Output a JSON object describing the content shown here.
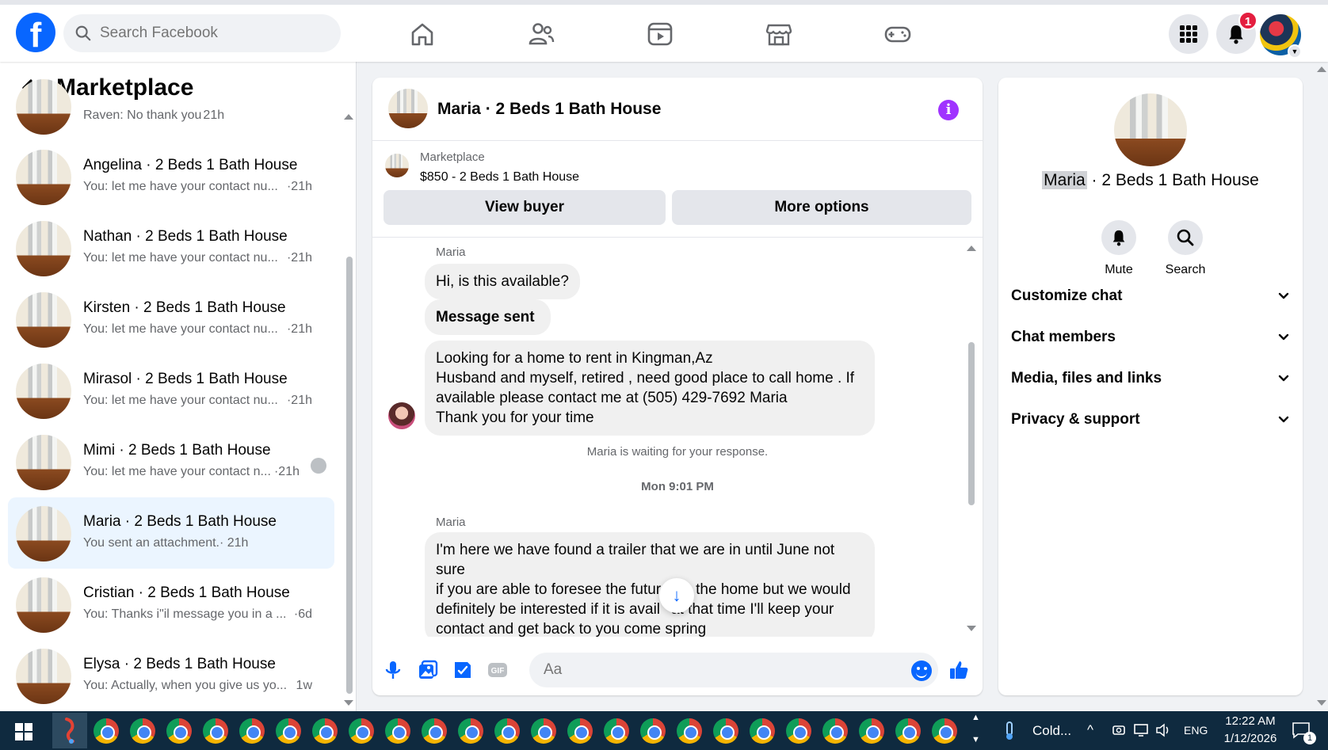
{
  "topbar": {
    "search_placeholder": "Search Facebook",
    "notification_count": "1"
  },
  "sidebar": {
    "title": "Marketplace",
    "conversations": [
      {
        "name": "",
        "preview": "Raven: No thank you",
        "time": "21h"
      },
      {
        "name": "Angelina · 2 Beds 1 Bath House",
        "preview": "You: let me have your contact nu...",
        "time": "·21h"
      },
      {
        "name": "Nathan · 2 Beds 1 Bath House",
        "preview": "You: let me have your contact nu...",
        "time": "·21h"
      },
      {
        "name": "Kirsten · 2 Beds 1 Bath House",
        "preview": "You: let me have your contact nu...",
        "time": "·21h"
      },
      {
        "name": "Mirasol · 2 Beds 1 Bath House",
        "preview": "You: let me have your contact nu...",
        "time": "·21h"
      },
      {
        "name": "Mimi · 2 Beds 1 Bath House",
        "preview": "You: let me have your contact n...",
        "time": "·21h"
      },
      {
        "name": "Maria · 2 Beds 1 Bath House",
        "preview": "You sent an attachment.",
        "time": "· 21h"
      },
      {
        "name": "Cristian · 2 Beds 1 Bath House",
        "preview": "You: Thanks i\"il message you in a ...",
        "time": "·6d"
      },
      {
        "name": "Elysa · 2 Beds 1 Bath House",
        "preview": "You: Actually, when you give us yo...",
        "time": "1w"
      }
    ]
  },
  "chat": {
    "title": "Maria · 2 Beds 1 Bath House",
    "listing_source": "Marketplace",
    "listing_title": "$850 - 2 Beds 1 Bath House",
    "view_buyer": "View buyer",
    "more_options": "More options",
    "sender": "Maria",
    "msg1": "Hi, is this available?",
    "msg2": "Message sent",
    "msg3_lines": [
      "Looking for a home to rent in Kingman,Az",
      "Husband and myself, retired , need good place to call home . If",
      "available please contact me at (505) 429-7692 Maria",
      "Thank you for your time"
    ],
    "waiting": "Maria is waiting for your response.",
    "timestamp": "Mon 9:01 PM",
    "msg4_lines": [
      "I'm here we have found a trailer that we are in until June not sure",
      "if you are able to foresee the futur",
      "the home but we would",
      "definitely be interested if it is avail",
      "at that time I'll keep your",
      "contact and get back to you come spring"
    ],
    "input_placeholder": "Aa"
  },
  "details": {
    "name_highlight": "Maria",
    "name_rest": " · 2 Beds 1 Bath House",
    "mute": "Mute",
    "search": "Search",
    "sections": [
      "Customize chat",
      "Chat members",
      "Media, files and links",
      "Privacy & support"
    ]
  },
  "taskbar": {
    "weather": "Cold...",
    "lang": "ENG",
    "time": "12:22 AM",
    "date": "1/12/2026",
    "notifications": "1"
  },
  "colors": {
    "brand": "#0866ff",
    "info": "#a033ff",
    "active_conv": "#ebf5ff"
  }
}
